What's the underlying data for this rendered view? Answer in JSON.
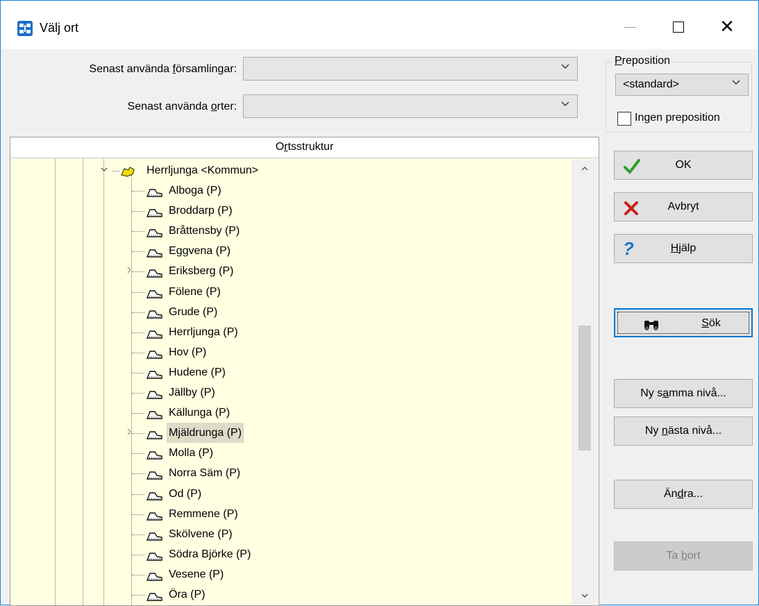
{
  "window": {
    "title": "Välj ort",
    "app_icon": "family-tree-icon"
  },
  "recent_parishes": {
    "label_before": "Senast använda ",
    "label_underlined": "f",
    "label_after": "örsamlingar:",
    "value": ""
  },
  "recent_places": {
    "label_before": "Senast använda ",
    "label_underlined": "o",
    "label_after": "rter:",
    "value": ""
  },
  "preposition": {
    "group_title_underlined": "P",
    "group_title_rest": "reposition",
    "selected": "<standard>",
    "no_preposition_label": "Ingen preposition",
    "no_preposition_checked": false
  },
  "tree": {
    "header_before": "O",
    "header_underlined": "r",
    "header_after": "tsstruktur",
    "root": "Herrljunga <Kommun>",
    "items": [
      {
        "label": "Alboga (P)",
        "expandable": false,
        "selected": false
      },
      {
        "label": "Broddarp (P)",
        "expandable": false,
        "selected": false
      },
      {
        "label": "Bråttensby (P)",
        "expandable": false,
        "selected": false
      },
      {
        "label": "Eggvena (P)",
        "expandable": false,
        "selected": false
      },
      {
        "label": "Eriksberg (P)",
        "expandable": true,
        "selected": false
      },
      {
        "label": "Fölene (P)",
        "expandable": false,
        "selected": false
      },
      {
        "label": "Grude (P)",
        "expandable": false,
        "selected": false
      },
      {
        "label": "Herrljunga (P)",
        "expandable": false,
        "selected": false
      },
      {
        "label": "Hov (P)",
        "expandable": false,
        "selected": false
      },
      {
        "label": "Hudene (P)",
        "expandable": false,
        "selected": false
      },
      {
        "label": "Jällby (P)",
        "expandable": false,
        "selected": false
      },
      {
        "label": "Källunga (P)",
        "expandable": false,
        "selected": false
      },
      {
        "label": "Mjäldrunga (P)",
        "expandable": true,
        "selected": true
      },
      {
        "label": "Molla (P)",
        "expandable": false,
        "selected": false
      },
      {
        "label": "Norra Säm (P)",
        "expandable": false,
        "selected": false
      },
      {
        "label": "Od (P)",
        "expandable": false,
        "selected": false
      },
      {
        "label": "Remmene (P)",
        "expandable": false,
        "selected": false
      },
      {
        "label": "Skölvene (P)",
        "expandable": false,
        "selected": false
      },
      {
        "label": "Södra Björke (P)",
        "expandable": false,
        "selected": false
      },
      {
        "label": "Vesene (P)",
        "expandable": false,
        "selected": false
      },
      {
        "label": "Öra (P)",
        "expandable": false,
        "selected": false
      }
    ]
  },
  "buttons": {
    "ok": "OK",
    "cancel": "Avbryt",
    "help_u": "H",
    "help_rest": "jälp",
    "search_u": "S",
    "search_rest": "ök",
    "new_same_before": "Ny s",
    "new_same_u": "a",
    "new_same_after": "mma nivå...",
    "new_next_before": "Ny ",
    "new_next_u": "n",
    "new_next_after": "ästa nivå...",
    "edit_before": "Än",
    "edit_u": "d",
    "edit_after": "ra...",
    "delete_before": "Ta ",
    "delete_u": "b",
    "delete_after": "ort",
    "delete_disabled": true
  },
  "colors": {
    "tree_background": "#ffffe1",
    "ok_check": "#2e9e2e",
    "cancel_x": "#c8201a",
    "help_q": "#1a73c8",
    "selection": "#dcdcc8"
  }
}
